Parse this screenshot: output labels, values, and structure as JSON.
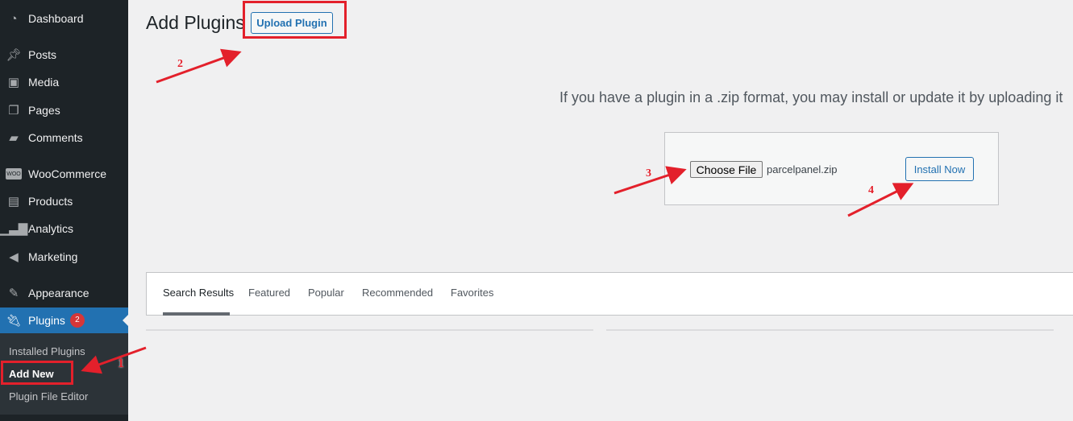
{
  "sidebar": {
    "items": [
      {
        "label": "Dashboard",
        "icon": "dashboard-icon"
      },
      {
        "label": "Posts",
        "icon": "pin-icon"
      },
      {
        "label": "Media",
        "icon": "media-icon"
      },
      {
        "label": "Pages",
        "icon": "pages-icon"
      },
      {
        "label": "Comments",
        "icon": "comment-icon"
      },
      {
        "label": "WooCommerce",
        "icon": "woo-icon"
      },
      {
        "label": "Products",
        "icon": "archive-icon"
      },
      {
        "label": "Analytics",
        "icon": "bar-chart-icon"
      },
      {
        "label": "Marketing",
        "icon": "megaphone-icon"
      },
      {
        "label": "Appearance",
        "icon": "brush-icon"
      },
      {
        "label": "Plugins",
        "icon": "plugin-icon",
        "badge": "2"
      }
    ],
    "submenu": [
      "Installed Plugins",
      "Add New",
      "Plugin File Editor"
    ]
  },
  "page": {
    "title": "Add Plugins",
    "upload_label": "Upload Plugin",
    "help_text": "If you have a plugin in a .zip format, you may install or update it by uploading it",
    "choose_label": "Choose File",
    "file_name": "parcelpanel.zip",
    "install_label": "Install Now"
  },
  "tabs": [
    "Search Results",
    "Featured",
    "Popular",
    "Recommended",
    "Favorites"
  ],
  "annotations": {
    "n1": "1",
    "n2": "2",
    "n3": "3",
    "n4": "4",
    "color": "#e3202b"
  },
  "colors": {
    "accent": "#2271b1",
    "sidebar": "#1d2327"
  }
}
